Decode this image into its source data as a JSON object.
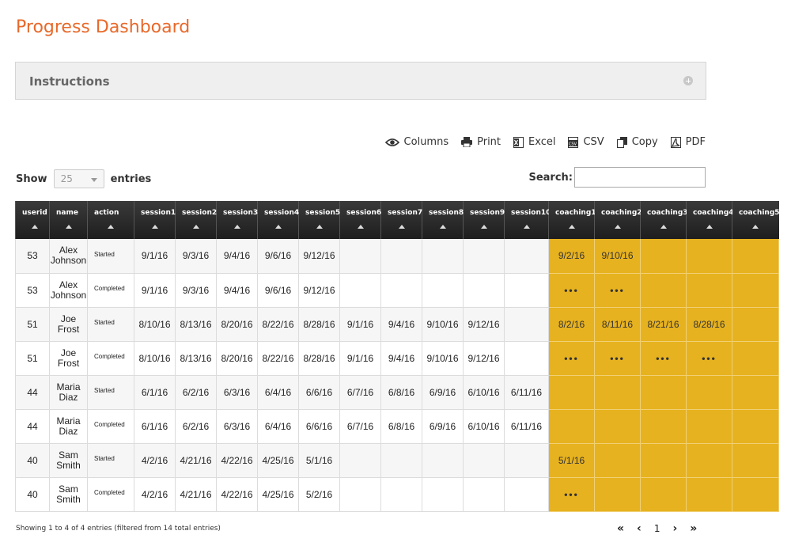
{
  "page_title": "Progress Dashboard",
  "instructions": {
    "label": "Instructions",
    "icon": "plus-circle-icon"
  },
  "toolbar": [
    {
      "label": "Columns",
      "icon": "eye-icon"
    },
    {
      "label": "Print",
      "icon": "printer-icon"
    },
    {
      "label": "Excel",
      "icon": "excel-icon"
    },
    {
      "label": "CSV",
      "icon": "csv-icon"
    },
    {
      "label": "Copy",
      "icon": "copy-icon"
    },
    {
      "label": "PDF",
      "icon": "pdf-icon"
    }
  ],
  "length": {
    "show_label": "Show",
    "value": "25",
    "entries_label": "entries"
  },
  "search": {
    "label": "Search:",
    "value": ""
  },
  "columns": [
    "userid",
    "name",
    "action",
    "session1",
    "session2",
    "session3",
    "session4",
    "session5",
    "session6",
    "session7",
    "session8",
    "session9",
    "session10",
    "coaching1",
    "coaching2",
    "coaching3",
    "coaching4",
    "coaching5"
  ],
  "rows": [
    {
      "userid": "53",
      "name": [
        "Alex",
        "Johnson"
      ],
      "action": "Started",
      "sessions": [
        "9/1/16",
        "9/3/16",
        "9/4/16",
        "9/6/16",
        "9/12/16",
        "",
        "",
        "",
        "",
        ""
      ],
      "coaching": [
        "9/2/16",
        "9/10/16",
        "",
        "",
        ""
      ]
    },
    {
      "userid": "53",
      "name": [
        "Alex",
        "Johnson"
      ],
      "action": "Completed",
      "sessions": [
        "9/1/16",
        "9/3/16",
        "9/4/16",
        "9/6/16",
        "9/12/16",
        "",
        "",
        "",
        "",
        ""
      ],
      "coaching": [
        "•••",
        "•••",
        "",
        "",
        ""
      ]
    },
    {
      "userid": "51",
      "name": [
        "Joe",
        "Frost"
      ],
      "action": "Started",
      "sessions": [
        "8/10/16",
        "8/13/16",
        "8/20/16",
        "8/22/16",
        "8/28/16",
        "9/1/16",
        "9/4/16",
        "9/10/16",
        "9/12/16",
        ""
      ],
      "coaching": [
        "8/2/16",
        "8/11/16",
        "8/21/16",
        "8/28/16",
        ""
      ]
    },
    {
      "userid": "51",
      "name": [
        "Joe",
        "Frost"
      ],
      "action": "Completed",
      "sessions": [
        "8/10/16",
        "8/13/16",
        "8/20/16",
        "8/22/16",
        "8/28/16",
        "9/1/16",
        "9/4/16",
        "9/10/16",
        "9/12/16",
        ""
      ],
      "coaching": [
        "•••",
        "•••",
        "•••",
        "•••",
        ""
      ]
    },
    {
      "userid": "44",
      "name": [
        "Maria",
        "Diaz"
      ],
      "action": "Started",
      "sessions": [
        "6/1/16",
        "6/2/16",
        "6/3/16",
        "6/4/16",
        "6/6/16",
        "6/7/16",
        "6/8/16",
        "6/9/16",
        "6/10/16",
        "6/11/16"
      ],
      "coaching": [
        "",
        "",
        "",
        "",
        ""
      ]
    },
    {
      "userid": "44",
      "name": [
        "Maria",
        "Diaz"
      ],
      "action": "Completed",
      "sessions": [
        "6/1/16",
        "6/2/16",
        "6/3/16",
        "6/4/16",
        "6/6/16",
        "6/7/16",
        "6/8/16",
        "6/9/16",
        "6/10/16",
        "6/11/16"
      ],
      "coaching": [
        "",
        "",
        "",
        "",
        ""
      ]
    },
    {
      "userid": "40",
      "name": [
        "Sam",
        "Smith"
      ],
      "action": "Started",
      "sessions": [
        "4/2/16",
        "4/21/16",
        "4/22/16",
        "4/25/16",
        "5/1/16",
        "",
        "",
        "",
        "",
        ""
      ],
      "coaching": [
        "5/1/16",
        "",
        "",
        "",
        ""
      ]
    },
    {
      "userid": "40",
      "name": [
        "Sam",
        "Smith"
      ],
      "action": "Completed",
      "sessions": [
        "4/2/16",
        "4/21/16",
        "4/22/16",
        "4/25/16",
        "5/2/16",
        "",
        "",
        "",
        "",
        ""
      ],
      "coaching": [
        "•••",
        "",
        "",
        "",
        ""
      ]
    }
  ],
  "footer_info": "Showing 1 to 4 of 4 entries (filtered from 14 total entries)",
  "pagination": {
    "first": "«",
    "prev": "‹",
    "current": "1",
    "next": "›",
    "last": "»"
  },
  "colors": {
    "title": "#e8692a",
    "coaching_bg": "#e7b21f",
    "header_bg": "#2a2a2a"
  }
}
